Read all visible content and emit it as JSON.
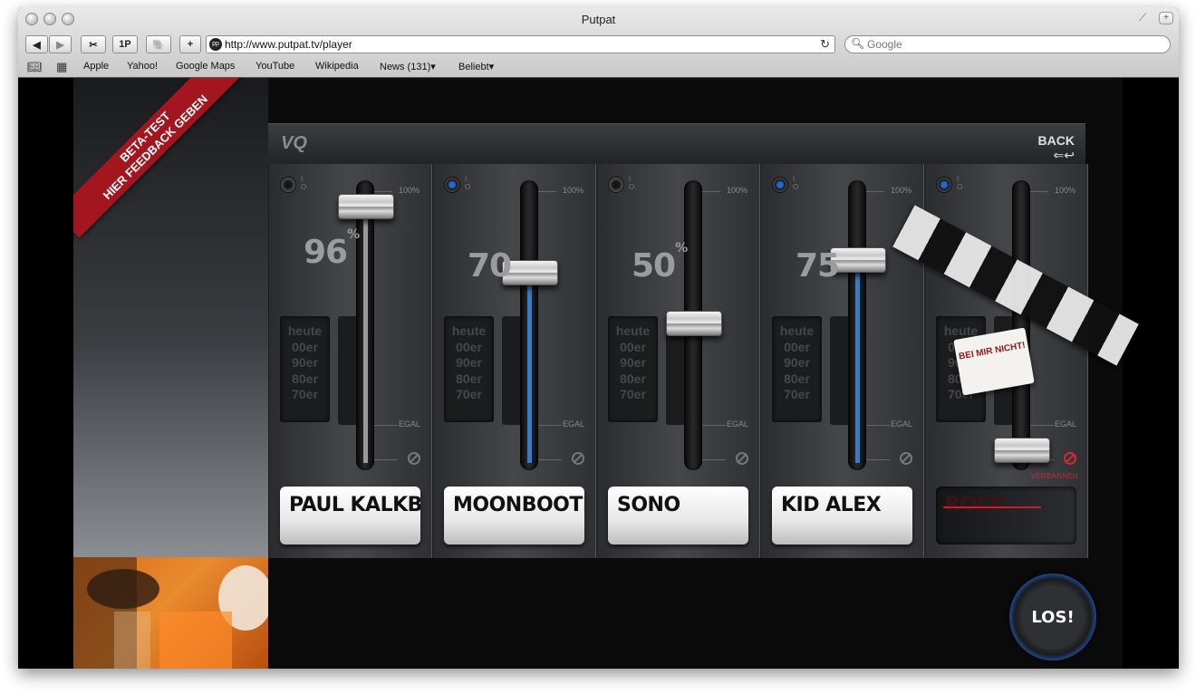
{
  "window": {
    "title": "Putpat"
  },
  "toolbar": {
    "back_icon": "back-arrow-icon",
    "forward_icon": "forward-arrow-icon",
    "onepassword_label": "1P",
    "add_label": "+",
    "url": "http://www.putpat.tv/player",
    "search_placeholder": "Google"
  },
  "bookmarks": {
    "items": [
      {
        "label": "Apple"
      },
      {
        "label": "Yahoo!"
      },
      {
        "label": "Google Maps"
      },
      {
        "label": "YouTube"
      },
      {
        "label": "Wikipedia"
      },
      {
        "label": "News (131)▾"
      },
      {
        "label": "Beliebt▾"
      }
    ]
  },
  "page": {
    "beta_line1": "BETA-TEST",
    "beta_line2": "HIER FEEDBACK GEBEN",
    "logo": "VQ",
    "back_label": "BACK",
    "los_label": "LOS!",
    "egal_label": "EGAL",
    "max_label": "100%",
    "banned_label": "VERBANNEN",
    "sticker_text": "BEI MIR NICHT!",
    "decades": [
      "heute",
      "00er",
      "90er",
      "80er",
      "70er"
    ],
    "channels": [
      {
        "name": "PAUL KALKBR...",
        "value": "96",
        "pct": "%",
        "level": 96,
        "active": false,
        "banned": false
      },
      {
        "name": "MOONBOOTICA",
        "value": "70",
        "pct": "",
        "level": 70,
        "active": true,
        "banned": false
      },
      {
        "name": "SONO",
        "value": "50",
        "pct": "%",
        "level": 50,
        "active": false,
        "banned": false
      },
      {
        "name": "KID ALEX",
        "value": "75",
        "pct": "",
        "level": 75,
        "active": true,
        "banned": false
      },
      {
        "name": "ROCK",
        "value": "",
        "pct": "",
        "level": 0,
        "active": true,
        "banned": true
      }
    ]
  }
}
